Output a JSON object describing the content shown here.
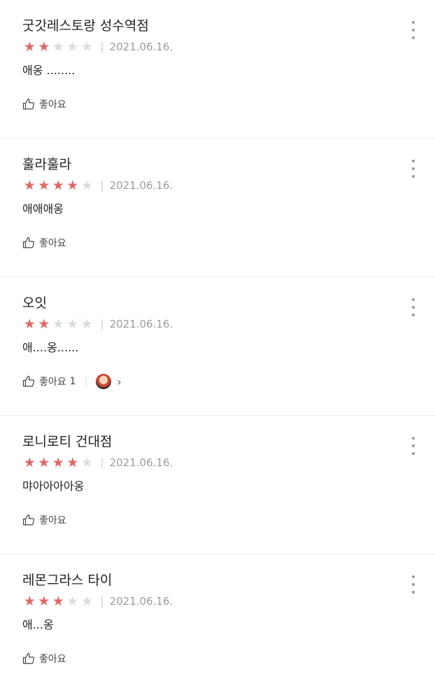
{
  "reviews": [
    {
      "name": "굿갓레스토랑 성수역점",
      "rating": 2,
      "date": "2021.06.16.",
      "content": "애옹 ........",
      "like_label": "좋아요",
      "like_count": ""
    },
    {
      "name": "훌라훌라",
      "rating": 4,
      "date": "2021.06.16.",
      "content": "애애애옹",
      "like_label": "좋아요",
      "like_count": ""
    },
    {
      "name": "오잇",
      "rating": 2,
      "date": "2021.06.16.",
      "content": "애....옹......",
      "like_label": "좋아요",
      "like_count": "1"
    },
    {
      "name": "로니로티 건대점",
      "rating": 4,
      "date": "2021.06.16.",
      "content": "먀아아아아옹",
      "like_label": "좋아요",
      "like_count": ""
    },
    {
      "name": "레몬그라스 타이",
      "rating": 3,
      "date": "2021.06.16.",
      "content": "애...옹",
      "like_label": "좋아요",
      "like_count": ""
    }
  ],
  "icons": {
    "star": "★",
    "separator": "|",
    "chevron": "›",
    "thumb": "thumbs-up-icon",
    "more": "more-vertical-icon"
  },
  "colors": {
    "star_on": "#e06868",
    "star_off": "#dcdcdc",
    "date": "#9a9a9a"
  }
}
